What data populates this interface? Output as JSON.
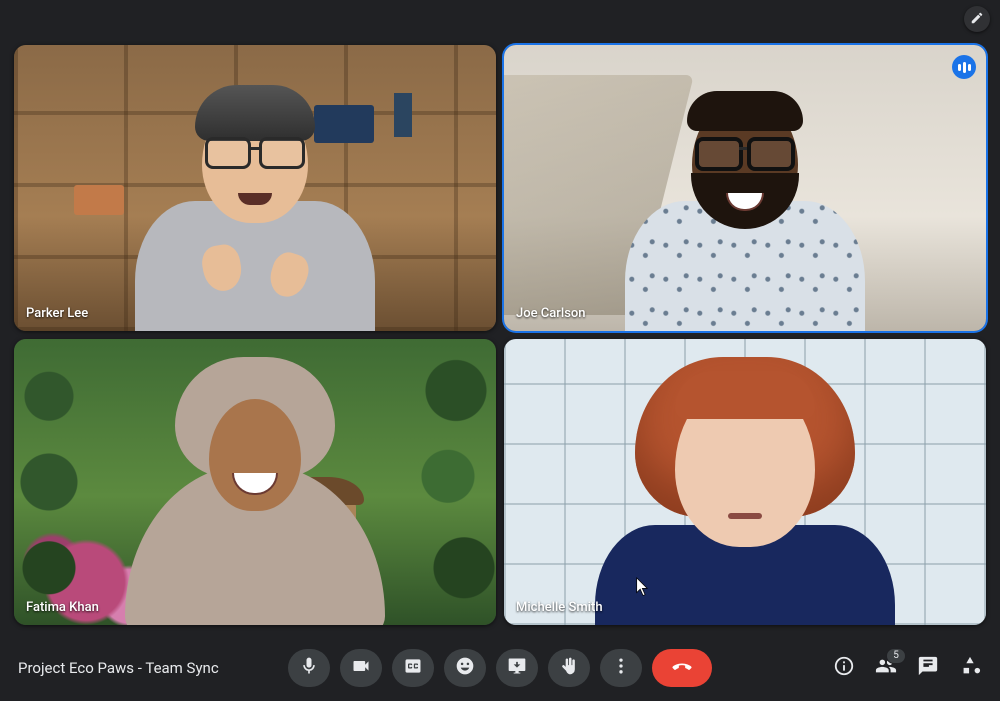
{
  "meeting": {
    "title": "Project Eco Paws - Team Sync"
  },
  "participants": [
    {
      "name": "Parker Lee",
      "speaking": false
    },
    {
      "name": "Joe Carlson",
      "speaking": true
    },
    {
      "name": "Fatima Khan",
      "speaking": false
    },
    {
      "name": "Michelle Smith",
      "speaking": false
    }
  ],
  "counts": {
    "people_badge": "5"
  },
  "icons": {
    "edit": "edit-icon",
    "mic": "mic-icon",
    "camera": "camera-icon",
    "cc": "closed-captions-icon",
    "emoji": "emoji-icon",
    "present": "present-screen-icon",
    "raise_hand": "raise-hand-icon",
    "more": "more-vert-icon",
    "end_call": "call-end-icon",
    "info": "info-icon",
    "people": "people-icon",
    "chat": "chat-icon",
    "activities": "activities-shapes-icon",
    "audio_indicator": "audio-level-icon"
  },
  "colors": {
    "accent": "#1a73e8",
    "end_call": "#ea4335",
    "bg": "#202124"
  }
}
